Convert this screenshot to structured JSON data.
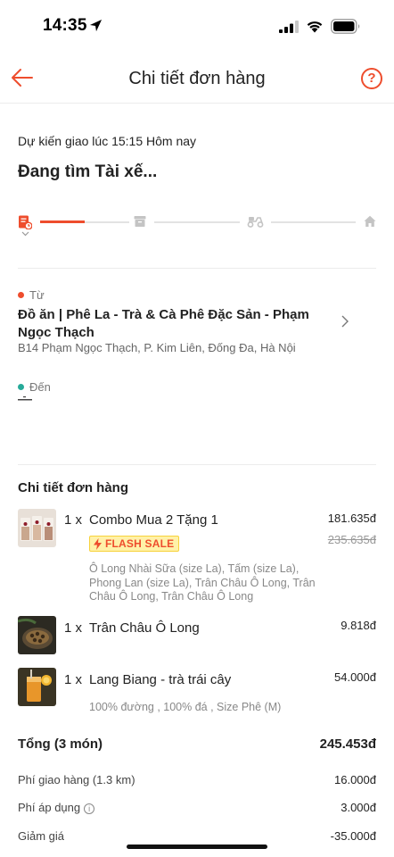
{
  "status_bar": {
    "time": "14:35"
  },
  "nav": {
    "title": "Chi tiết đơn hàng",
    "help_glyph": "?"
  },
  "delivery": {
    "eta": "Dự kiến giao lúc 15:15 Hôm nay",
    "status": "Đang tìm Tài xế...",
    "tracker_steps": [
      "order-placed-icon",
      "package-icon",
      "scooter-icon",
      "home-icon"
    ],
    "tracker_progress": 0.5
  },
  "route": {
    "from_label": "Từ",
    "from_name": "Đồ ăn | Phê La - Trà & Cà Phê Đặc Sản - Phạm Ngọc Thạch",
    "from_address": "B14 Phạm Ngọc Thạch, P. Kim Liên, Đống Đa, Hà Nội",
    "to_label": "Đến"
  },
  "order": {
    "section_title": "Chi tiết đơn hàng",
    "items": [
      {
        "qty": "1 x",
        "name": "Combo Mua 2 Tặng 1",
        "price": "181.635đ",
        "original_price": "235.635đ",
        "badge": "FLASH SALE",
        "options": "Ô Long Nhài Sữa (size La), Tấm (size La), Phong Lan (size La), Trân Châu Ô Long, Trân Châu Ô Long, Trân Châu Ô Long"
      },
      {
        "qty": "1 x",
        "name": "Trân Châu Ô Long",
        "price": "9.818đ"
      },
      {
        "qty": "1 x",
        "name": "Lang Biang - trà trái cây",
        "price": "54.000đ",
        "options": "100% đường , 100% đá , Size Phê (M)"
      }
    ]
  },
  "summary": {
    "total_label": "Tổng (3 món)",
    "total_value": "245.453đ",
    "fees": [
      {
        "label": "Phí giao hàng (1.3 km)",
        "value": "16.000đ"
      },
      {
        "label": "Phí áp dụng",
        "value": "3.000đ",
        "info": "i"
      },
      {
        "label": "Giảm giá",
        "value": "-35.000đ"
      }
    ]
  },
  "colors": {
    "accent": "#ee4d2d",
    "from_dot": "#ee4d2d",
    "to_dot": "#26aa99",
    "flash_bg": "#fff1a8"
  }
}
